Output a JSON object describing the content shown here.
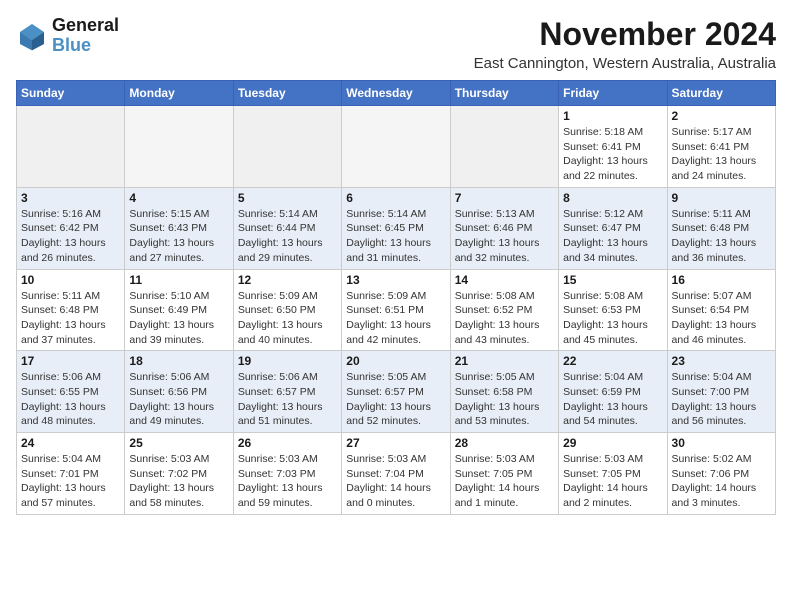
{
  "logo": {
    "text_general": "General",
    "text_blue": "Blue"
  },
  "title": "November 2024",
  "subtitle": "East Cannington, Western Australia, Australia",
  "days_of_week": [
    "Sunday",
    "Monday",
    "Tuesday",
    "Wednesday",
    "Thursday",
    "Friday",
    "Saturday"
  ],
  "weeks": [
    [
      {
        "day": "",
        "empty": true
      },
      {
        "day": "",
        "empty": true
      },
      {
        "day": "",
        "empty": true
      },
      {
        "day": "",
        "empty": true
      },
      {
        "day": "",
        "empty": true
      },
      {
        "day": "1",
        "info": "Sunrise: 5:18 AM\nSunset: 6:41 PM\nDaylight: 13 hours\nand 22 minutes."
      },
      {
        "day": "2",
        "info": "Sunrise: 5:17 AM\nSunset: 6:41 PM\nDaylight: 13 hours\nand 24 minutes."
      }
    ],
    [
      {
        "day": "3",
        "info": "Sunrise: 5:16 AM\nSunset: 6:42 PM\nDaylight: 13 hours\nand 26 minutes."
      },
      {
        "day": "4",
        "info": "Sunrise: 5:15 AM\nSunset: 6:43 PM\nDaylight: 13 hours\nand 27 minutes."
      },
      {
        "day": "5",
        "info": "Sunrise: 5:14 AM\nSunset: 6:44 PM\nDaylight: 13 hours\nand 29 minutes."
      },
      {
        "day": "6",
        "info": "Sunrise: 5:14 AM\nSunset: 6:45 PM\nDaylight: 13 hours\nand 31 minutes."
      },
      {
        "day": "7",
        "info": "Sunrise: 5:13 AM\nSunset: 6:46 PM\nDaylight: 13 hours\nand 32 minutes."
      },
      {
        "day": "8",
        "info": "Sunrise: 5:12 AM\nSunset: 6:47 PM\nDaylight: 13 hours\nand 34 minutes."
      },
      {
        "day": "9",
        "info": "Sunrise: 5:11 AM\nSunset: 6:48 PM\nDaylight: 13 hours\nand 36 minutes."
      }
    ],
    [
      {
        "day": "10",
        "info": "Sunrise: 5:11 AM\nSunset: 6:48 PM\nDaylight: 13 hours\nand 37 minutes."
      },
      {
        "day": "11",
        "info": "Sunrise: 5:10 AM\nSunset: 6:49 PM\nDaylight: 13 hours\nand 39 minutes."
      },
      {
        "day": "12",
        "info": "Sunrise: 5:09 AM\nSunset: 6:50 PM\nDaylight: 13 hours\nand 40 minutes."
      },
      {
        "day": "13",
        "info": "Sunrise: 5:09 AM\nSunset: 6:51 PM\nDaylight: 13 hours\nand 42 minutes."
      },
      {
        "day": "14",
        "info": "Sunrise: 5:08 AM\nSunset: 6:52 PM\nDaylight: 13 hours\nand 43 minutes."
      },
      {
        "day": "15",
        "info": "Sunrise: 5:08 AM\nSunset: 6:53 PM\nDaylight: 13 hours\nand 45 minutes."
      },
      {
        "day": "16",
        "info": "Sunrise: 5:07 AM\nSunset: 6:54 PM\nDaylight: 13 hours\nand 46 minutes."
      }
    ],
    [
      {
        "day": "17",
        "info": "Sunrise: 5:06 AM\nSunset: 6:55 PM\nDaylight: 13 hours\nand 48 minutes."
      },
      {
        "day": "18",
        "info": "Sunrise: 5:06 AM\nSunset: 6:56 PM\nDaylight: 13 hours\nand 49 minutes."
      },
      {
        "day": "19",
        "info": "Sunrise: 5:06 AM\nSunset: 6:57 PM\nDaylight: 13 hours\nand 51 minutes."
      },
      {
        "day": "20",
        "info": "Sunrise: 5:05 AM\nSunset: 6:57 PM\nDaylight: 13 hours\nand 52 minutes."
      },
      {
        "day": "21",
        "info": "Sunrise: 5:05 AM\nSunset: 6:58 PM\nDaylight: 13 hours\nand 53 minutes."
      },
      {
        "day": "22",
        "info": "Sunrise: 5:04 AM\nSunset: 6:59 PM\nDaylight: 13 hours\nand 54 minutes."
      },
      {
        "day": "23",
        "info": "Sunrise: 5:04 AM\nSunset: 7:00 PM\nDaylight: 13 hours\nand 56 minutes."
      }
    ],
    [
      {
        "day": "24",
        "info": "Sunrise: 5:04 AM\nSunset: 7:01 PM\nDaylight: 13 hours\nand 57 minutes."
      },
      {
        "day": "25",
        "info": "Sunrise: 5:03 AM\nSunset: 7:02 PM\nDaylight: 13 hours\nand 58 minutes."
      },
      {
        "day": "26",
        "info": "Sunrise: 5:03 AM\nSunset: 7:03 PM\nDaylight: 13 hours\nand 59 minutes."
      },
      {
        "day": "27",
        "info": "Sunrise: 5:03 AM\nSunset: 7:04 PM\nDaylight: 14 hours\nand 0 minutes."
      },
      {
        "day": "28",
        "info": "Sunrise: 5:03 AM\nSunset: 7:05 PM\nDaylight: 14 hours\nand 1 minute."
      },
      {
        "day": "29",
        "info": "Sunrise: 5:03 AM\nSunset: 7:05 PM\nDaylight: 14 hours\nand 2 minutes."
      },
      {
        "day": "30",
        "info": "Sunrise: 5:02 AM\nSunset: 7:06 PM\nDaylight: 14 hours\nand 3 minutes."
      }
    ]
  ]
}
